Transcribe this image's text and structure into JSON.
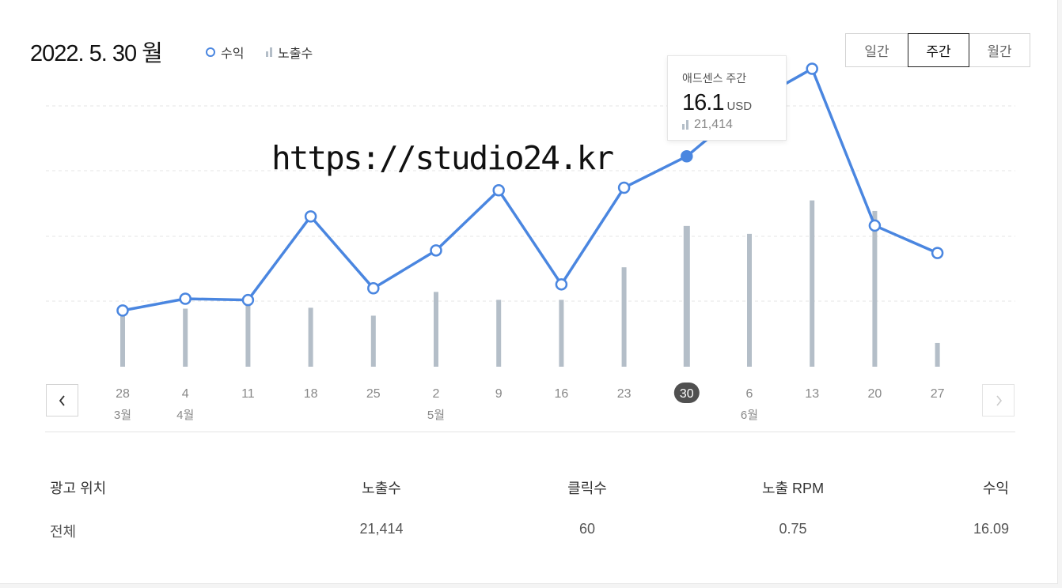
{
  "header": {
    "date_title": "2022. 5. 30 월",
    "legend_revenue": "수익",
    "legend_impressions": "노출수"
  },
  "period_tabs": [
    {
      "label": "일간",
      "active": false
    },
    {
      "label": "주간",
      "active": true
    },
    {
      "label": "월간",
      "active": false
    }
  ],
  "tooltip": {
    "title": "애드센스 주간",
    "value": "16.1",
    "unit": "USD",
    "impressions": "21,414"
  },
  "watermark": "https://studio24.kr",
  "chart_data": {
    "type": "line",
    "x_labels": [
      "28",
      "4",
      "11",
      "18",
      "25",
      "2",
      "9",
      "16",
      "23",
      "30",
      "6",
      "13",
      "20",
      "27"
    ],
    "month_labels": [
      "3월",
      "4월",
      "",
      "",
      "",
      "5월",
      "",
      "",
      "",
      "",
      "6월",
      "",
      "",
      ""
    ],
    "selected_index": 9,
    "grid": true,
    "ylim": [
      0,
      20.2
    ],
    "impressions_max": 30000,
    "series": [
      {
        "name": "수익",
        "color": "#4a86e0",
        "values": [
          4.3,
          5.2,
          5.1,
          11.5,
          6.0,
          8.9,
          13.5,
          6.3,
          13.7,
          16.1,
          20.1,
          22.8,
          10.8,
          8.7
        ]
      },
      {
        "name": "노출수",
        "color": "#b4bec8",
        "values": [
          7000,
          6600,
          7600,
          6700,
          5800,
          8500,
          7600,
          7600,
          11300,
          16000,
          15100,
          18900,
          17700,
          2700
        ]
      }
    ]
  },
  "table": {
    "headers": [
      "광고 위치",
      "노출수",
      "클릭수",
      "노출 RPM",
      "수익"
    ],
    "rows": [
      [
        "전체",
        "21,414",
        "60",
        "0.75",
        "16.09"
      ]
    ]
  }
}
